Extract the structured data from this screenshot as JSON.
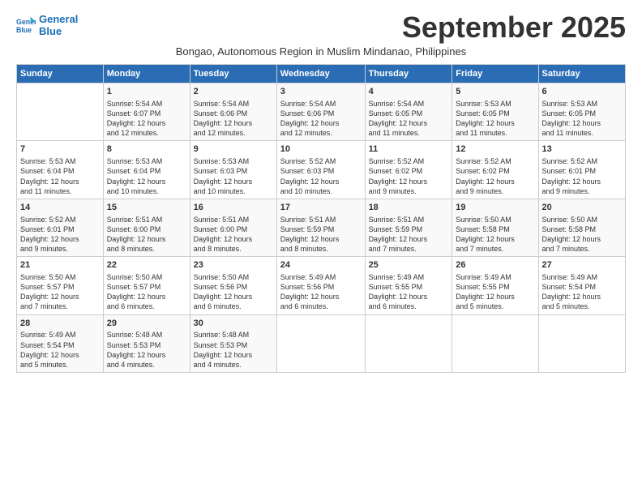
{
  "logo": {
    "line1": "General",
    "line2": "Blue"
  },
  "title": "September 2025",
  "subtitle": "Bongao, Autonomous Region in Muslim Mindanao, Philippines",
  "days_header": [
    "Sunday",
    "Monday",
    "Tuesday",
    "Wednesday",
    "Thursday",
    "Friday",
    "Saturday"
  ],
  "weeks": [
    [
      {
        "day": "",
        "info": ""
      },
      {
        "day": "1",
        "info": "Sunrise: 5:54 AM\nSunset: 6:07 PM\nDaylight: 12 hours\nand 12 minutes."
      },
      {
        "day": "2",
        "info": "Sunrise: 5:54 AM\nSunset: 6:06 PM\nDaylight: 12 hours\nand 12 minutes."
      },
      {
        "day": "3",
        "info": "Sunrise: 5:54 AM\nSunset: 6:06 PM\nDaylight: 12 hours\nand 12 minutes."
      },
      {
        "day": "4",
        "info": "Sunrise: 5:54 AM\nSunset: 6:05 PM\nDaylight: 12 hours\nand 11 minutes."
      },
      {
        "day": "5",
        "info": "Sunrise: 5:53 AM\nSunset: 6:05 PM\nDaylight: 12 hours\nand 11 minutes."
      },
      {
        "day": "6",
        "info": "Sunrise: 5:53 AM\nSunset: 6:05 PM\nDaylight: 12 hours\nand 11 minutes."
      }
    ],
    [
      {
        "day": "7",
        "info": "Sunrise: 5:53 AM\nSunset: 6:04 PM\nDaylight: 12 hours\nand 11 minutes."
      },
      {
        "day": "8",
        "info": "Sunrise: 5:53 AM\nSunset: 6:04 PM\nDaylight: 12 hours\nand 10 minutes."
      },
      {
        "day": "9",
        "info": "Sunrise: 5:53 AM\nSunset: 6:03 PM\nDaylight: 12 hours\nand 10 minutes."
      },
      {
        "day": "10",
        "info": "Sunrise: 5:52 AM\nSunset: 6:03 PM\nDaylight: 12 hours\nand 10 minutes."
      },
      {
        "day": "11",
        "info": "Sunrise: 5:52 AM\nSunset: 6:02 PM\nDaylight: 12 hours\nand 9 minutes."
      },
      {
        "day": "12",
        "info": "Sunrise: 5:52 AM\nSunset: 6:02 PM\nDaylight: 12 hours\nand 9 minutes."
      },
      {
        "day": "13",
        "info": "Sunrise: 5:52 AM\nSunset: 6:01 PM\nDaylight: 12 hours\nand 9 minutes."
      }
    ],
    [
      {
        "day": "14",
        "info": "Sunrise: 5:52 AM\nSunset: 6:01 PM\nDaylight: 12 hours\nand 9 minutes."
      },
      {
        "day": "15",
        "info": "Sunrise: 5:51 AM\nSunset: 6:00 PM\nDaylight: 12 hours\nand 8 minutes."
      },
      {
        "day": "16",
        "info": "Sunrise: 5:51 AM\nSunset: 6:00 PM\nDaylight: 12 hours\nand 8 minutes."
      },
      {
        "day": "17",
        "info": "Sunrise: 5:51 AM\nSunset: 5:59 PM\nDaylight: 12 hours\nand 8 minutes."
      },
      {
        "day": "18",
        "info": "Sunrise: 5:51 AM\nSunset: 5:59 PM\nDaylight: 12 hours\nand 7 minutes."
      },
      {
        "day": "19",
        "info": "Sunrise: 5:50 AM\nSunset: 5:58 PM\nDaylight: 12 hours\nand 7 minutes."
      },
      {
        "day": "20",
        "info": "Sunrise: 5:50 AM\nSunset: 5:58 PM\nDaylight: 12 hours\nand 7 minutes."
      }
    ],
    [
      {
        "day": "21",
        "info": "Sunrise: 5:50 AM\nSunset: 5:57 PM\nDaylight: 12 hours\nand 7 minutes."
      },
      {
        "day": "22",
        "info": "Sunrise: 5:50 AM\nSunset: 5:57 PM\nDaylight: 12 hours\nand 6 minutes."
      },
      {
        "day": "23",
        "info": "Sunrise: 5:50 AM\nSunset: 5:56 PM\nDaylight: 12 hours\nand 6 minutes."
      },
      {
        "day": "24",
        "info": "Sunrise: 5:49 AM\nSunset: 5:56 PM\nDaylight: 12 hours\nand 6 minutes."
      },
      {
        "day": "25",
        "info": "Sunrise: 5:49 AM\nSunset: 5:55 PM\nDaylight: 12 hours\nand 6 minutes."
      },
      {
        "day": "26",
        "info": "Sunrise: 5:49 AM\nSunset: 5:55 PM\nDaylight: 12 hours\nand 5 minutes."
      },
      {
        "day": "27",
        "info": "Sunrise: 5:49 AM\nSunset: 5:54 PM\nDaylight: 12 hours\nand 5 minutes."
      }
    ],
    [
      {
        "day": "28",
        "info": "Sunrise: 5:49 AM\nSunset: 5:54 PM\nDaylight: 12 hours\nand 5 minutes."
      },
      {
        "day": "29",
        "info": "Sunrise: 5:48 AM\nSunset: 5:53 PM\nDaylight: 12 hours\nand 4 minutes."
      },
      {
        "day": "30",
        "info": "Sunrise: 5:48 AM\nSunset: 5:53 PM\nDaylight: 12 hours\nand 4 minutes."
      },
      {
        "day": "",
        "info": ""
      },
      {
        "day": "",
        "info": ""
      },
      {
        "day": "",
        "info": ""
      },
      {
        "day": "",
        "info": ""
      }
    ]
  ]
}
